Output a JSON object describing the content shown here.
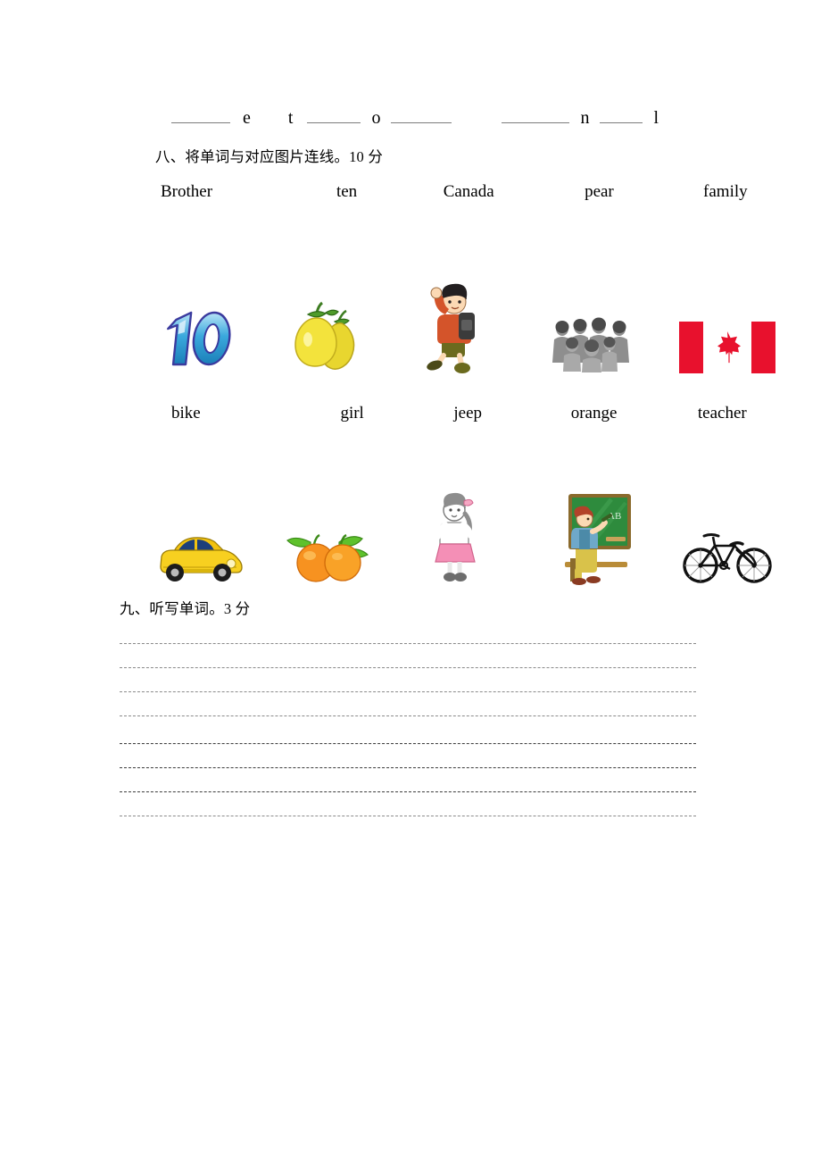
{
  "document": {
    "type": "worksheet",
    "language": "zh-CN"
  },
  "fill_blanks": {
    "items": [
      {
        "kind": "blank",
        "label": ""
      },
      {
        "kind": "letter",
        "label": "e"
      },
      {
        "kind": "letter",
        "label": "t"
      },
      {
        "kind": "blank",
        "label": ""
      },
      {
        "kind": "letter",
        "label": "o"
      },
      {
        "kind": "blank",
        "label": ""
      },
      {
        "kind": "blank",
        "label": ""
      },
      {
        "kind": "letter",
        "label": "n"
      },
      {
        "kind": "blank",
        "label": ""
      },
      {
        "kind": "letter",
        "label": "l"
      }
    ],
    "letters": {
      "e": "e",
      "t": "t",
      "o": "o",
      "n": "n",
      "l": "l"
    }
  },
  "section_eight": {
    "heading": "八、将单词与对应图片连线。10 分",
    "points": "10 分",
    "words_row_1": [
      {
        "label": "Brother"
      },
      {
        "label": "ten"
      },
      {
        "label": "Canada"
      },
      {
        "label": "pear"
      },
      {
        "label": "family"
      }
    ],
    "pictures_row_1": [
      {
        "icon": "number-ten-icon",
        "alt": "10"
      },
      {
        "icon": "pears-icon",
        "alt": "pears"
      },
      {
        "icon": "boy-waving-icon",
        "alt": "boy"
      },
      {
        "icon": "family-photo-icon",
        "alt": "family photo"
      },
      {
        "icon": "canada-flag-icon",
        "alt": "Canada flag"
      }
    ],
    "words_row_2": [
      {
        "label": "bike"
      },
      {
        "label": "girl"
      },
      {
        "label": "jeep"
      },
      {
        "label": "orange"
      },
      {
        "label": "teacher"
      }
    ],
    "pictures_row_2": [
      {
        "icon": "yellow-car-icon",
        "alt": "yellow jeep"
      },
      {
        "icon": "oranges-icon",
        "alt": "oranges"
      },
      {
        "icon": "girl-icon",
        "alt": "girl"
      },
      {
        "icon": "teacher-chalkboard-icon",
        "alt": "teacher at chalkboard"
      },
      {
        "icon": "bicycle-icon",
        "alt": "bicycle"
      }
    ],
    "chalkboard_text": "AB"
  },
  "section_nine": {
    "heading": "九、听写单词。3 分",
    "points": "3 分",
    "line_groups": [
      {
        "lines": 4
      },
      {
        "lines": 4
      }
    ]
  },
  "colors": {
    "ink": "#000000",
    "rule": "#8a8a8a",
    "flag_red": "#e8112d",
    "pear_yellow": "#f3e03a",
    "orange": "#f68b1f",
    "chalkboard_green": "#2e8b3d",
    "car_yellow": "#f5c518",
    "ten_blue": "#35a8df"
  }
}
